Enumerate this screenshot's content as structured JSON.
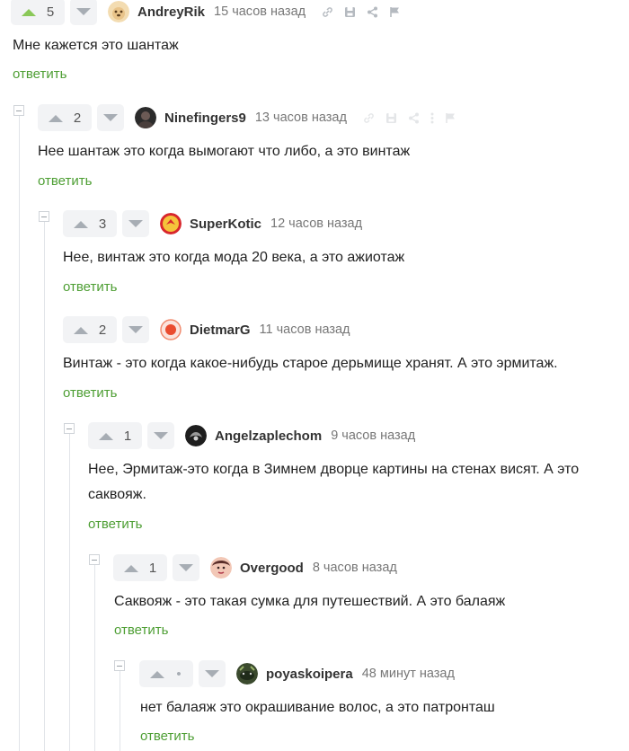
{
  "ui": {
    "up_color": "#8ac858",
    "arrow_color": "#a7adb4",
    "reply_color": "#4d9e33"
  },
  "comments": [
    {
      "votes": "5",
      "author": "AndreyRik",
      "time": "15 часов назад",
      "text": "Мне кажется это шантаж",
      "reply": "ответить",
      "avatar_icon": "dog-avatar-icon"
    },
    {
      "votes": "2",
      "author": "Ninefingers9",
      "time": "13 часов назад",
      "text": "Нее шантаж это когда вымогают что либо, а это винтаж",
      "reply": "ответить",
      "avatar_icon": "dark-portrait-avatar-icon"
    },
    {
      "votes": "3",
      "author": "SuperKotic",
      "time": "12 часов назад",
      "text": "Нее, винтаж это когда мода 20 века, а это ажиотаж",
      "reply": "ответить",
      "avatar_icon": "red-logo-avatar-icon"
    },
    {
      "votes": "2",
      "author": "DietmarG",
      "time": "11 часов назад",
      "text": "Винтаж - это когда какое-нибудь старое дерьмище хранят. А это эрмитаж.",
      "reply": "ответить",
      "avatar_icon": "record-button-avatar-icon"
    },
    {
      "votes": "1",
      "author": "Angelzaplechom",
      "time": "9 часов назад",
      "text": "Нее, Эрмитаж-это когда в Зимнем дворце картины на стенах висят. А это саквояж.",
      "reply": "ответить",
      "avatar_icon": "grey-wing-avatar-icon"
    },
    {
      "votes": "1",
      "author": "Overgood",
      "time": "8 часов назад",
      "text": "Саквояж - это такая сумка для путешествий. А это балаяж",
      "reply": "ответить",
      "avatar_icon": "face-avatar-icon"
    },
    {
      "votes": "•",
      "author": "poyaskoipera",
      "time": "48 минут назад",
      "text": "нет балаяж это окрашивание волос, а это патронташ",
      "reply": "ответить",
      "avatar_icon": "animal-avatar-icon"
    }
  ]
}
